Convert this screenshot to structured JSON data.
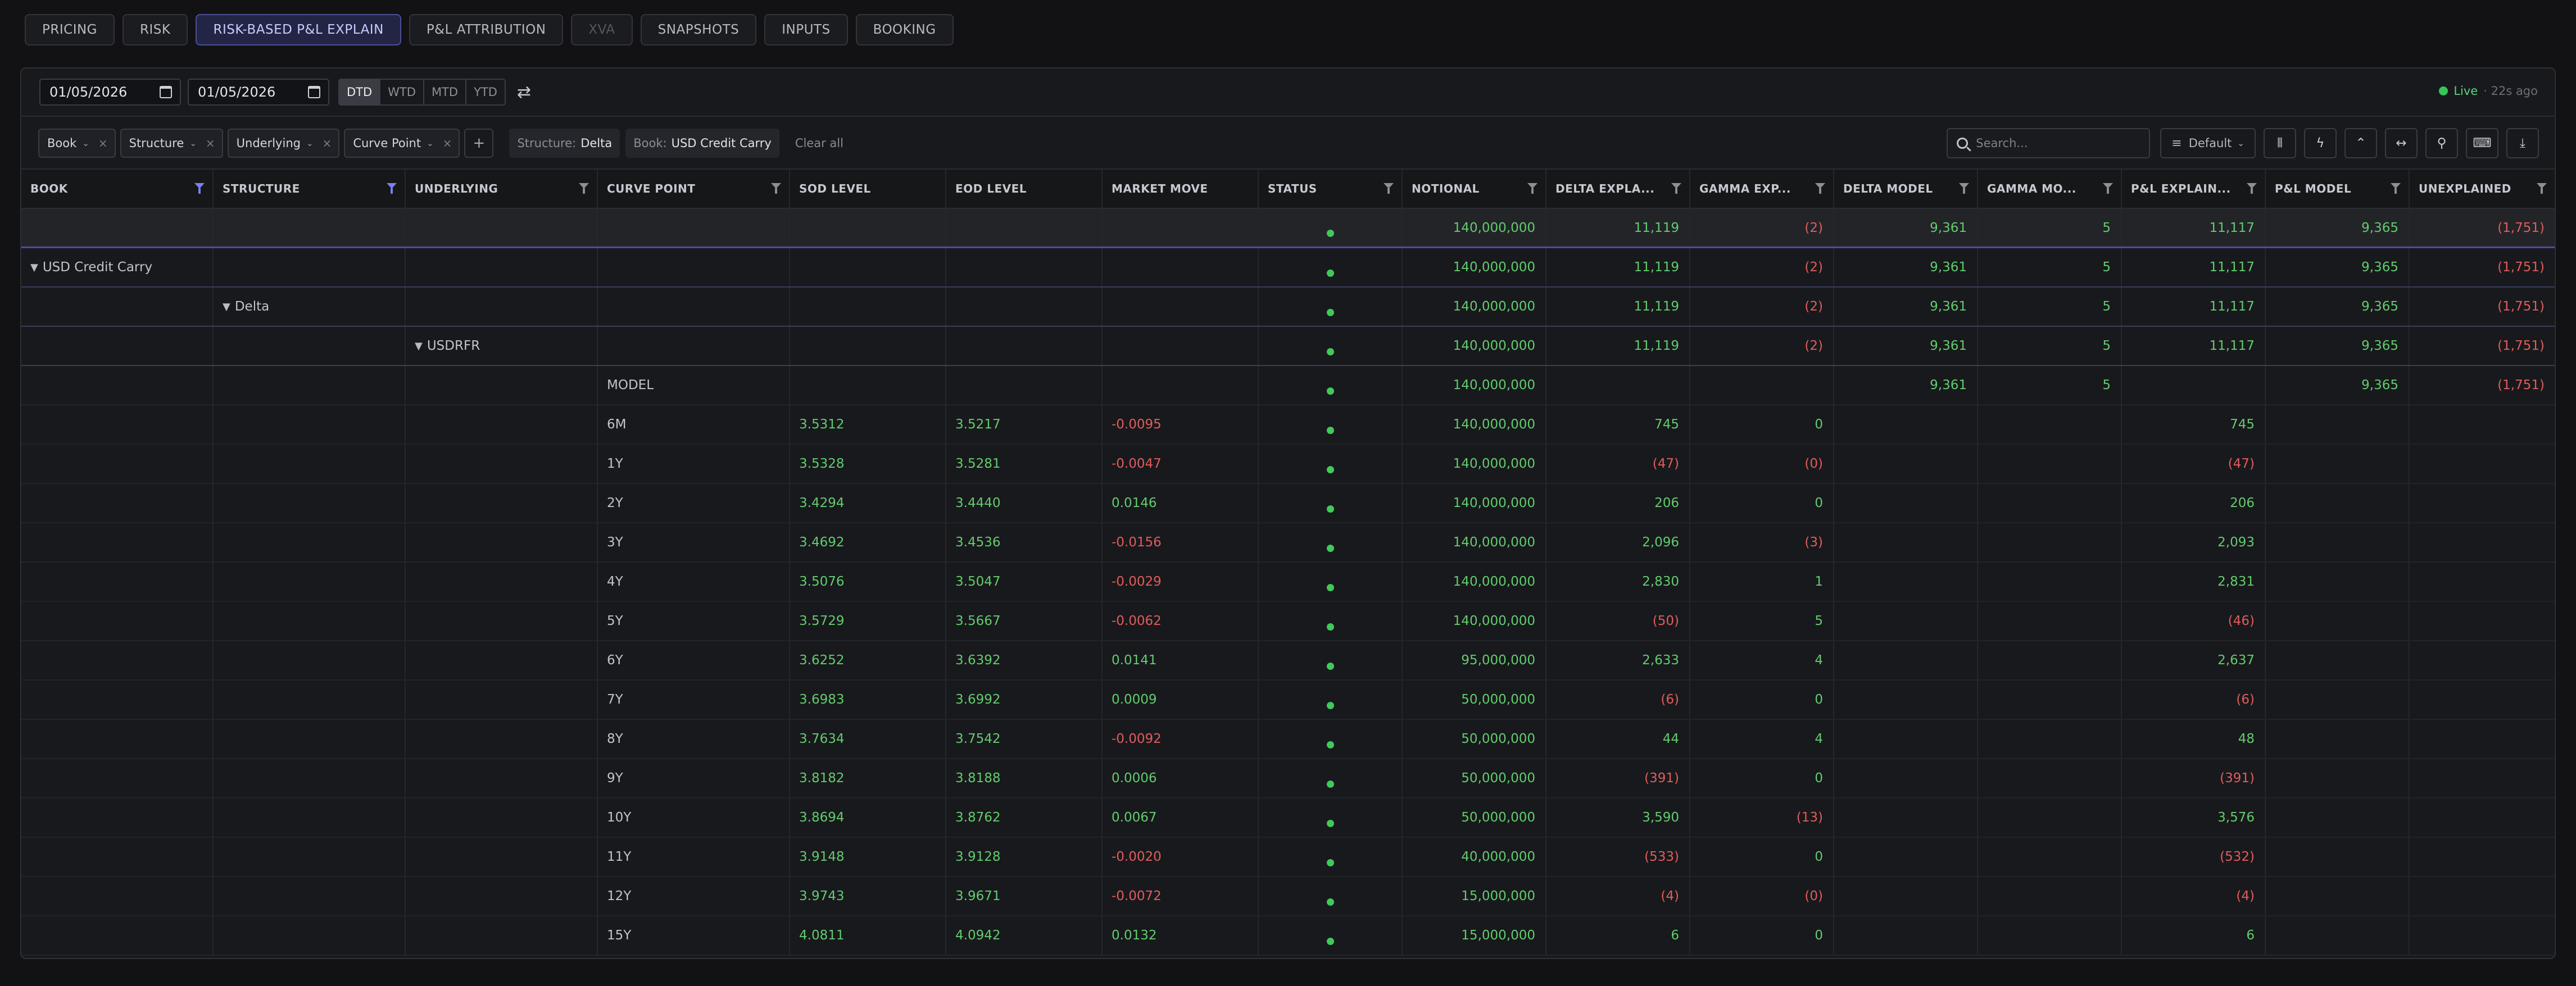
{
  "tabs": [
    {
      "label": "PRICING",
      "state": "normal"
    },
    {
      "label": "RISK",
      "state": "normal"
    },
    {
      "label": "RISK-BASED P&L EXPLAIN",
      "state": "active"
    },
    {
      "label": "P&L ATTRIBUTION",
      "state": "normal"
    },
    {
      "label": "XVA",
      "state": "disabled"
    },
    {
      "label": "SNAPSHOTS",
      "state": "normal"
    },
    {
      "label": "INPUTS",
      "state": "normal"
    },
    {
      "label": "BOOKING",
      "state": "normal"
    }
  ],
  "dates": {
    "start": "01/05/2026",
    "end": "01/05/2026"
  },
  "periods": [
    {
      "label": "DTD",
      "active": true
    },
    {
      "label": "WTD",
      "active": false
    },
    {
      "label": "MTD",
      "active": false
    },
    {
      "label": "YTD",
      "active": false
    }
  ],
  "status": {
    "live_label": "Live",
    "age": "· 22s ago"
  },
  "group_chips": [
    "Book",
    "Structure",
    "Underlying",
    "Curve Point"
  ],
  "add_label": "+",
  "active_filters": [
    {
      "key": "Structure:",
      "value": "Delta"
    },
    {
      "key": "Book:",
      "value": "USD Credit Carry"
    }
  ],
  "clear_all": "Clear all",
  "search": {
    "placeholder": "Search..."
  },
  "view_select": {
    "label": "Default"
  },
  "toolbar_icons": [
    "columns-icon",
    "lightning-icon",
    "chevron-up-icon",
    "expand-horizontal-icon",
    "pin-icon",
    "keyboard-icon",
    "download-icon"
  ],
  "columns": [
    {
      "label": "BOOK",
      "filter": "active"
    },
    {
      "label": "STRUCTURE",
      "filter": "active"
    },
    {
      "label": "UNDERLYING",
      "filter": "normal"
    },
    {
      "label": "CURVE POINT",
      "filter": "normal"
    },
    {
      "label": "SOD LEVEL",
      "filter": "none"
    },
    {
      "label": "EOD LEVEL",
      "filter": "none"
    },
    {
      "label": "MARKET MOVE",
      "filter": "none"
    },
    {
      "label": "STATUS",
      "filter": "normal"
    },
    {
      "label": "NOTIONAL",
      "filter": "normal"
    },
    {
      "label": "DELTA EXPLA...",
      "filter": "normal"
    },
    {
      "label": "GAMMA EXP...",
      "filter": "normal"
    },
    {
      "label": "DELTA MODEL",
      "filter": "normal"
    },
    {
      "label": "GAMMA MO...",
      "filter": "normal"
    },
    {
      "label": "P&L EXPLAIN...",
      "filter": "normal"
    },
    {
      "label": "P&L MODEL",
      "filter": "normal"
    },
    {
      "label": "UNEXPLAINED",
      "filter": "normal"
    }
  ],
  "rows": [
    {
      "kind": "total",
      "indent": -1,
      "label": "",
      "sod": "",
      "eod": "",
      "move": "",
      "notional": "140,000,000",
      "delta_explain": "11,119",
      "gamma_explain": "(2)",
      "delta_model": "9,361",
      "gamma_model": "5",
      "pnl_explain": "11,117",
      "pnl_model": "9,365",
      "unexplained": "(1,751)"
    },
    {
      "kind": "group",
      "indent": 0,
      "label": "USD Credit Carry",
      "sod": "",
      "eod": "",
      "move": "",
      "notional": "140,000,000",
      "delta_explain": "11,119",
      "gamma_explain": "(2)",
      "delta_model": "9,361",
      "gamma_model": "5",
      "pnl_explain": "11,117",
      "pnl_model": "9,365",
      "unexplained": "(1,751)"
    },
    {
      "kind": "group",
      "indent": 1,
      "label": "Delta",
      "sod": "",
      "eod": "",
      "move": "",
      "notional": "140,000,000",
      "delta_explain": "11,119",
      "gamma_explain": "(2)",
      "delta_model": "9,361",
      "gamma_model": "5",
      "pnl_explain": "11,117",
      "pnl_model": "9,365",
      "unexplained": "(1,751)"
    },
    {
      "kind": "group",
      "indent": 2,
      "label": "USDRFR",
      "sod": "",
      "eod": "",
      "move": "",
      "notional": "140,000,000",
      "delta_explain": "11,119",
      "gamma_explain": "(2)",
      "delta_model": "9,361",
      "gamma_model": "5",
      "pnl_explain": "11,117",
      "pnl_model": "9,365",
      "unexplained": "(1,751)"
    },
    {
      "kind": "leaf",
      "indent": 3,
      "label": "MODEL",
      "sod": "",
      "eod": "",
      "move": "",
      "notional": "140,000,000",
      "delta_explain": "",
      "gamma_explain": "",
      "delta_model": "9,361",
      "gamma_model": "5",
      "pnl_explain": "",
      "pnl_model": "9,365",
      "unexplained": "(1,751)"
    },
    {
      "kind": "leaf",
      "indent": 3,
      "label": "6M",
      "sod": "3.5312",
      "eod": "3.5217",
      "move": "-0.0095",
      "notional": "140,000,000",
      "delta_explain": "745",
      "gamma_explain": "0",
      "delta_model": "",
      "gamma_model": "",
      "pnl_explain": "745",
      "pnl_model": "",
      "unexplained": ""
    },
    {
      "kind": "leaf",
      "indent": 3,
      "label": "1Y",
      "sod": "3.5328",
      "eod": "3.5281",
      "move": "-0.0047",
      "notional": "140,000,000",
      "delta_explain": "(47)",
      "gamma_explain": "(0)",
      "delta_model": "",
      "gamma_model": "",
      "pnl_explain": "(47)",
      "pnl_model": "",
      "unexplained": ""
    },
    {
      "kind": "leaf",
      "indent": 3,
      "label": "2Y",
      "sod": "3.4294",
      "eod": "3.4440",
      "move": "0.0146",
      "notional": "140,000,000",
      "delta_explain": "206",
      "gamma_explain": "0",
      "delta_model": "",
      "gamma_model": "",
      "pnl_explain": "206",
      "pnl_model": "",
      "unexplained": ""
    },
    {
      "kind": "leaf",
      "indent": 3,
      "label": "3Y",
      "sod": "3.4692",
      "eod": "3.4536",
      "move": "-0.0156",
      "notional": "140,000,000",
      "delta_explain": "2,096",
      "gamma_explain": "(3)",
      "delta_model": "",
      "gamma_model": "",
      "pnl_explain": "2,093",
      "pnl_model": "",
      "unexplained": ""
    },
    {
      "kind": "leaf",
      "indent": 3,
      "label": "4Y",
      "sod": "3.5076",
      "eod": "3.5047",
      "move": "-0.0029",
      "notional": "140,000,000",
      "delta_explain": "2,830",
      "gamma_explain": "1",
      "delta_model": "",
      "gamma_model": "",
      "pnl_explain": "2,831",
      "pnl_model": "",
      "unexplained": ""
    },
    {
      "kind": "leaf",
      "indent": 3,
      "label": "5Y",
      "sod": "3.5729",
      "eod": "3.5667",
      "move": "-0.0062",
      "notional": "140,000,000",
      "delta_explain": "(50)",
      "gamma_explain": "5",
      "delta_model": "",
      "gamma_model": "",
      "pnl_explain": "(46)",
      "pnl_model": "",
      "unexplained": ""
    },
    {
      "kind": "leaf",
      "indent": 3,
      "label": "6Y",
      "sod": "3.6252",
      "eod": "3.6392",
      "move": "0.0141",
      "notional": "95,000,000",
      "delta_explain": "2,633",
      "gamma_explain": "4",
      "delta_model": "",
      "gamma_model": "",
      "pnl_explain": "2,637",
      "pnl_model": "",
      "unexplained": ""
    },
    {
      "kind": "leaf",
      "indent": 3,
      "label": "7Y",
      "sod": "3.6983",
      "eod": "3.6992",
      "move": "0.0009",
      "notional": "50,000,000",
      "delta_explain": "(6)",
      "gamma_explain": "0",
      "delta_model": "",
      "gamma_model": "",
      "pnl_explain": "(6)",
      "pnl_model": "",
      "unexplained": ""
    },
    {
      "kind": "leaf",
      "indent": 3,
      "label": "8Y",
      "sod": "3.7634",
      "eod": "3.7542",
      "move": "-0.0092",
      "notional": "50,000,000",
      "delta_explain": "44",
      "gamma_explain": "4",
      "delta_model": "",
      "gamma_model": "",
      "pnl_explain": "48",
      "pnl_model": "",
      "unexplained": ""
    },
    {
      "kind": "leaf",
      "indent": 3,
      "label": "9Y",
      "sod": "3.8182",
      "eod": "3.8188",
      "move": "0.0006",
      "notional": "50,000,000",
      "delta_explain": "(391)",
      "gamma_explain": "0",
      "delta_model": "",
      "gamma_model": "",
      "pnl_explain": "(391)",
      "pnl_model": "",
      "unexplained": ""
    },
    {
      "kind": "leaf",
      "indent": 3,
      "label": "10Y",
      "sod": "3.8694",
      "eod": "3.8762",
      "move": "0.0067",
      "notional": "50,000,000",
      "delta_explain": "3,590",
      "gamma_explain": "(13)",
      "delta_model": "",
      "gamma_model": "",
      "pnl_explain": "3,576",
      "pnl_model": "",
      "unexplained": ""
    },
    {
      "kind": "leaf",
      "indent": 3,
      "label": "11Y",
      "sod": "3.9148",
      "eod": "3.9128",
      "move": "-0.0020",
      "notional": "40,000,000",
      "delta_explain": "(533)",
      "gamma_explain": "0",
      "delta_model": "",
      "gamma_model": "",
      "pnl_explain": "(532)",
      "pnl_model": "",
      "unexplained": ""
    },
    {
      "kind": "leaf",
      "indent": 3,
      "label": "12Y",
      "sod": "3.9743",
      "eod": "3.9671",
      "move": "-0.0072",
      "notional": "15,000,000",
      "delta_explain": "(4)",
      "gamma_explain": "(0)",
      "delta_model": "",
      "gamma_model": "",
      "pnl_explain": "(4)",
      "pnl_model": "",
      "unexplained": ""
    },
    {
      "kind": "leaf",
      "indent": 3,
      "label": "15Y",
      "sod": "4.0811",
      "eod": "4.0942",
      "move": "0.0132",
      "notional": "15,000,000",
      "delta_explain": "6",
      "gamma_explain": "0",
      "delta_model": "",
      "gamma_model": "",
      "pnl_explain": "6",
      "pnl_model": "",
      "unexplained": ""
    }
  ],
  "colors": {
    "positive": "#62cc6e",
    "negative": "#e05c5c",
    "accent": "#7d7ff0",
    "live": "#34c759"
  }
}
